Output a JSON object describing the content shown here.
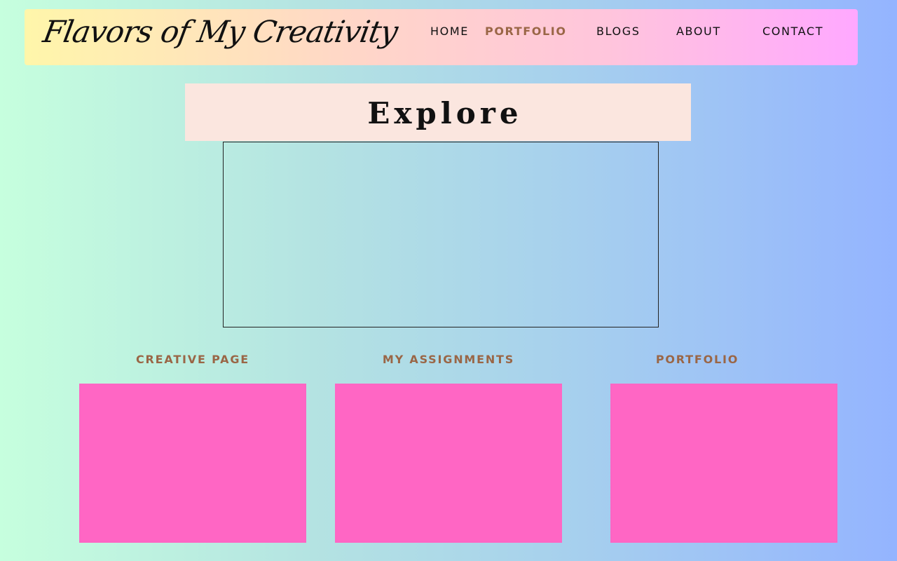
{
  "header": {
    "logo_text": "Flavors of My Creativity",
    "nav": [
      {
        "label": "HOME",
        "active": false
      },
      {
        "label": "PORTFOLIO",
        "active": true
      },
      {
        "label": "BLOGS",
        "active": false
      },
      {
        "label": "ABOUT",
        "active": false
      },
      {
        "label": "CONTACT",
        "active": false
      }
    ]
  },
  "main": {
    "explore_title": "Explore",
    "cards": [
      {
        "title": "CREATIVE PAGE"
      },
      {
        "title": "MY ASSIGNMENTS"
      },
      {
        "title": "PORTFOLIO"
      }
    ]
  },
  "colors": {
    "accent_text": "#9a6646",
    "card_fill": "#ff66c4",
    "banner_fill": "#fbe6df"
  }
}
